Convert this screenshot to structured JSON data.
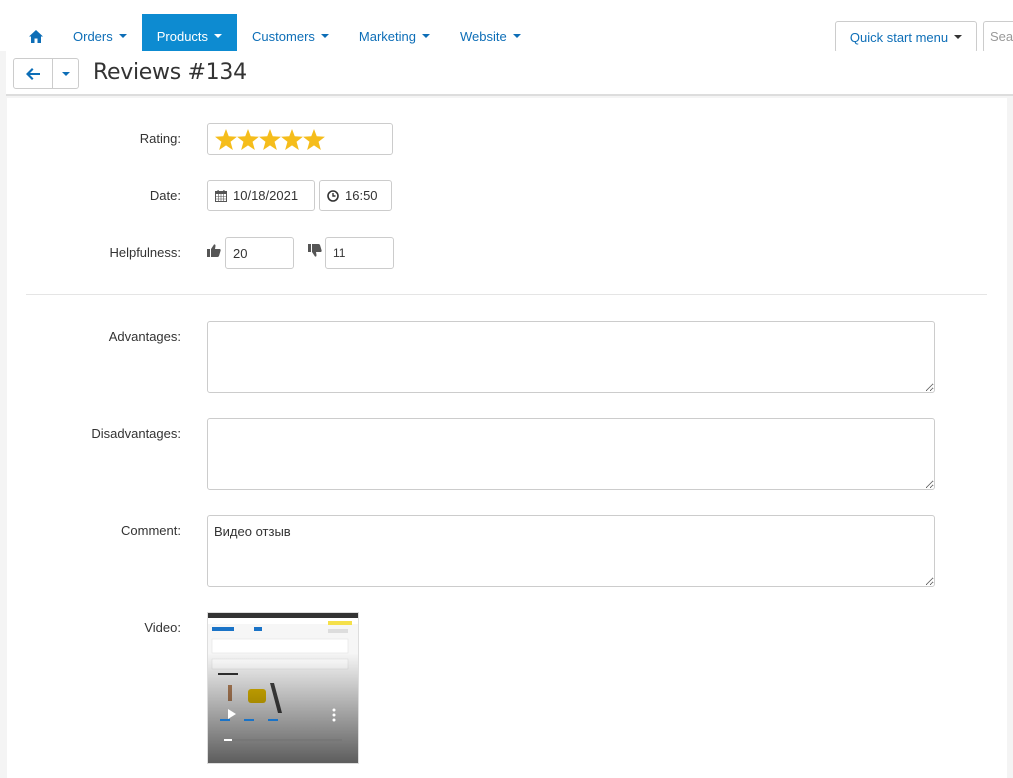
{
  "nav": {
    "items": [
      {
        "label": "Orders",
        "active": false
      },
      {
        "label": "Products",
        "active": true
      },
      {
        "label": "Customers",
        "active": false
      },
      {
        "label": "Marketing",
        "active": false
      },
      {
        "label": "Website",
        "active": false
      }
    ],
    "quick_start": "Quick start menu",
    "search_placeholder": "Sea"
  },
  "page": {
    "title": "Reviews #134"
  },
  "form": {
    "rating_label": "Rating:",
    "rating_value": 5,
    "rating_max": 5,
    "date_label": "Date:",
    "date_value": "10/18/2021",
    "time_value": "16:50",
    "helpfulness_label": "Helpfulness:",
    "likes": "20",
    "dislikes": "11",
    "advantages_label": "Advantages:",
    "advantages_value": "",
    "disadvantages_label": "Disadvantages:",
    "disadvantages_value": "",
    "comment_label": "Comment:",
    "comment_value": "Видео отзыв",
    "video_label": "Video:"
  },
  "colors": {
    "accent": "#0d8bd1",
    "link": "#0d6eb7",
    "star": "#f5bd1b"
  }
}
